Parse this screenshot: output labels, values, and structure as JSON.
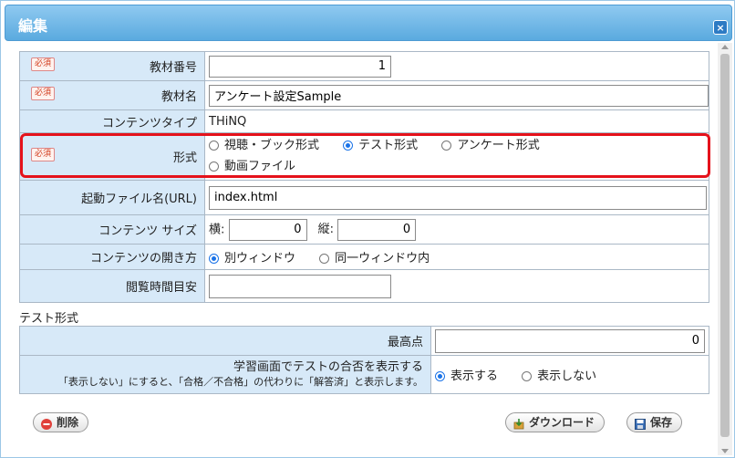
{
  "dialog": {
    "title": "編集",
    "close_label": "×"
  },
  "required_label": "必須",
  "form": {
    "material_number": {
      "label": "教材番号",
      "value": "1"
    },
    "material_name": {
      "label": "教材名",
      "value": "アンケート設定Sample"
    },
    "content_type": {
      "label": "コンテンツタイプ",
      "value": "THiNQ"
    },
    "format": {
      "label": "形式",
      "options": [
        "視聴・ブック形式",
        "テスト形式",
        "アンケート形式",
        "動画ファイル"
      ],
      "selected": "テスト形式"
    },
    "launch_file": {
      "label": "起動ファイル名(URL)",
      "value": "index.html"
    },
    "content_size": {
      "label": "コンテンツ サイズ",
      "width_label": "横:",
      "width_value": "0",
      "height_label": "縦:",
      "height_value": "0"
    },
    "open_method": {
      "label": "コンテンツの開き方",
      "options": [
        "別ウィンドウ",
        "同一ウィンドウ内"
      ],
      "selected": "別ウィンドウ"
    },
    "viewing_time": {
      "label": "閲覧時間目安",
      "value": ""
    }
  },
  "test_section": {
    "title": "テスト形式",
    "max_score": {
      "label": "最高点",
      "value": "0"
    },
    "show_pass": {
      "label": "学習画面でテストの合否を表示する",
      "note": "「表示しない」にすると、「合格／不合格」の代わりに「解答済」と表示します。",
      "options": [
        "表示する",
        "表示しない"
      ],
      "selected": "表示する"
    }
  },
  "buttons": {
    "delete": "削除",
    "download": "ダウンロード",
    "save": "保存"
  },
  "colors": {
    "accent": "#1a73e8",
    "highlight": "#e5121b",
    "label_bg": "#d7e9f8"
  }
}
